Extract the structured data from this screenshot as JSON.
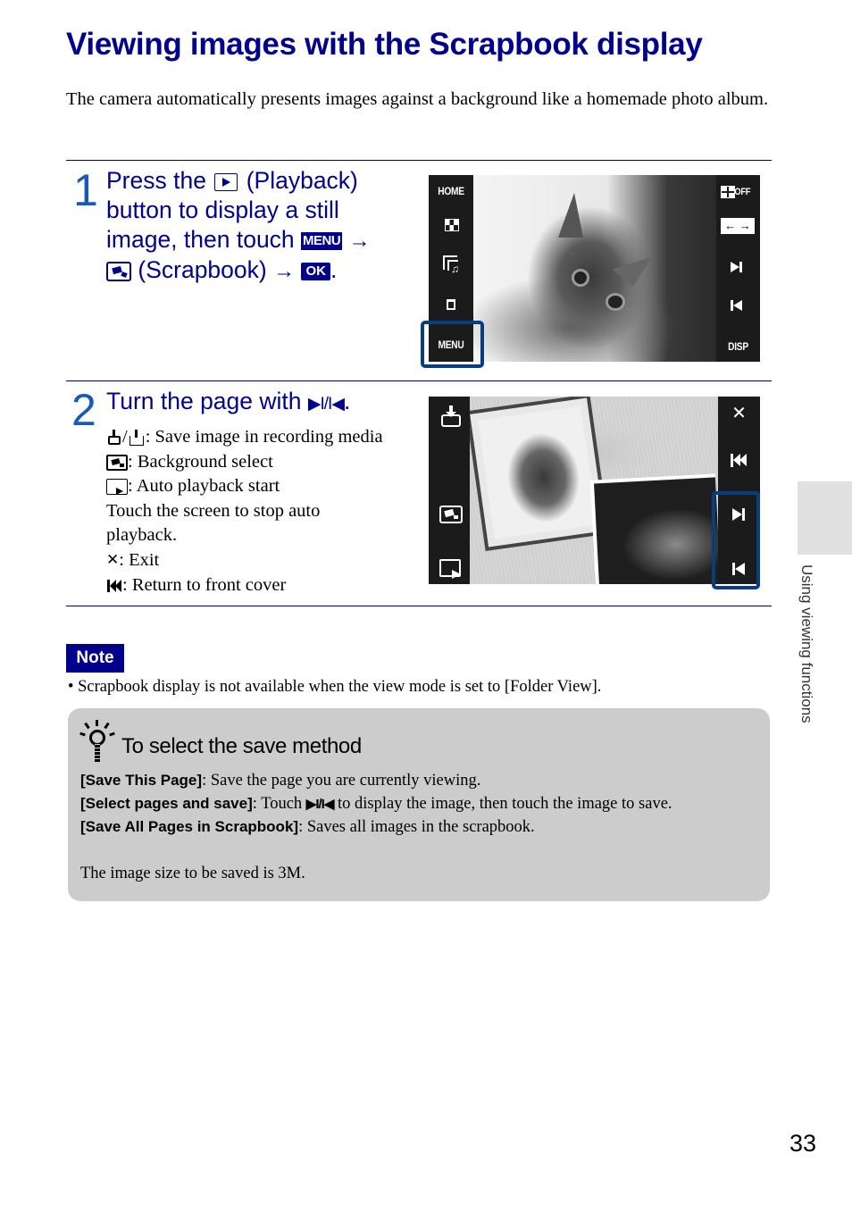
{
  "page": {
    "title": "Viewing images with the Scrapbook display",
    "intro": "The camera automatically presents images against a background like a homemade photo album.",
    "page_number": "33",
    "side_tab_label": "Using viewing functions"
  },
  "step1": {
    "number": "1",
    "line1_a": "Press the",
    "line1_b": "(Playback)",
    "line2": "button to display a still",
    "line3": "image, then touch",
    "menu_badge": "MENU",
    "arrow": "→",
    "line4_b": "(Scrapbook)",
    "ok_badge": "OK",
    "period": ".",
    "screen": {
      "left_buttons": [
        "HOME",
        "index-view",
        "slideshow",
        "delete",
        "MENU"
      ],
      "home_label": "HOME",
      "menu_label": "MENU",
      "disp_label": "DISP",
      "off_label": "OFF",
      "zoom_arrows": "← →",
      "highlighted": "MENU"
    }
  },
  "step2": {
    "number": "2",
    "heading": "Turn the page with",
    "heading_symbol": "▶I/I◀",
    "heading_period": ".",
    "items": [
      {
        "icon": "save-to-media-icon",
        "text": ": Save image in recording media"
      },
      {
        "icon": "background-select-icon",
        "text": ": Background select"
      },
      {
        "icon": "auto-playback-icon",
        "text": ": Auto playback start"
      },
      {
        "icon": "",
        "text": "Touch the screen to stop auto"
      },
      {
        "icon": "",
        "text": "playback."
      },
      {
        "icon": "exit-icon",
        "text": ": Exit"
      },
      {
        "icon": "front-cover-icon",
        "text": ": Return to front cover"
      }
    ],
    "screen": {
      "exit_glyph": "✕",
      "highlighted": "next/previous"
    }
  },
  "note": {
    "label": "Note",
    "bullets": [
      "• Scrapbook display is not available when the view mode is set to [Folder View]."
    ]
  },
  "tip": {
    "title": "To select the save method",
    "lines": [
      {
        "bold": "[Save This Page]",
        "text": ": Save the page you are currently viewing."
      },
      {
        "bold": "[Select pages and save]",
        "text_a": ": Touch ",
        "symbol": "▶I/I◀",
        "text_b": " to display the image, then touch the image to save."
      },
      {
        "bold": "[Save All Pages in Scrapbook]",
        "text": ": Saves all images in the scrapbook."
      }
    ],
    "footer": "The image size to be saved is 3M."
  }
}
